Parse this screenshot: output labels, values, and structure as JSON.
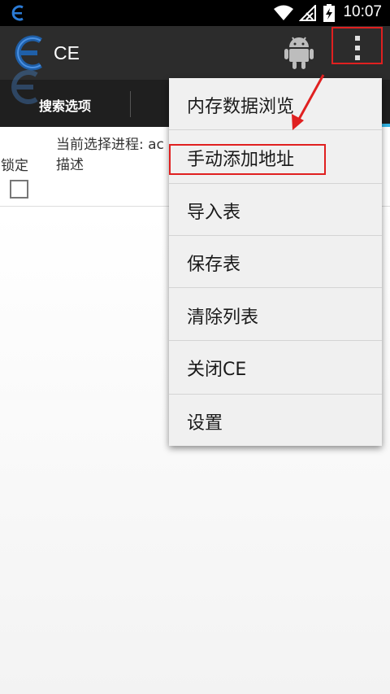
{
  "status_bar": {
    "time": "10:07"
  },
  "app_bar": {
    "title": "CE"
  },
  "tabs": [
    {
      "label": "搜索选项"
    }
  ],
  "content": {
    "process_label": "当前选择进程: ac",
    "lock_column": "锁定",
    "description_column": "描述"
  },
  "menu": {
    "items": [
      {
        "label": "内存数据浏览"
      },
      {
        "label": "手动添加地址"
      },
      {
        "label": "导入表"
      },
      {
        "label": "保存表"
      },
      {
        "label": "清除列表"
      },
      {
        "label": "关闭CE"
      },
      {
        "label": "设置"
      }
    ]
  },
  "colors": {
    "app_bar": "#2c2c2c",
    "tab_bar": "#1f1f1f",
    "accent": "#33b5e5",
    "annotation": "#e02020",
    "menu_background": "#f0f0f0"
  },
  "icons": [
    "cheat-engine-logo",
    "wifi-icon",
    "no-signal-icon",
    "battery-charging-icon",
    "android-icon",
    "overflow-menu-icon"
  ]
}
